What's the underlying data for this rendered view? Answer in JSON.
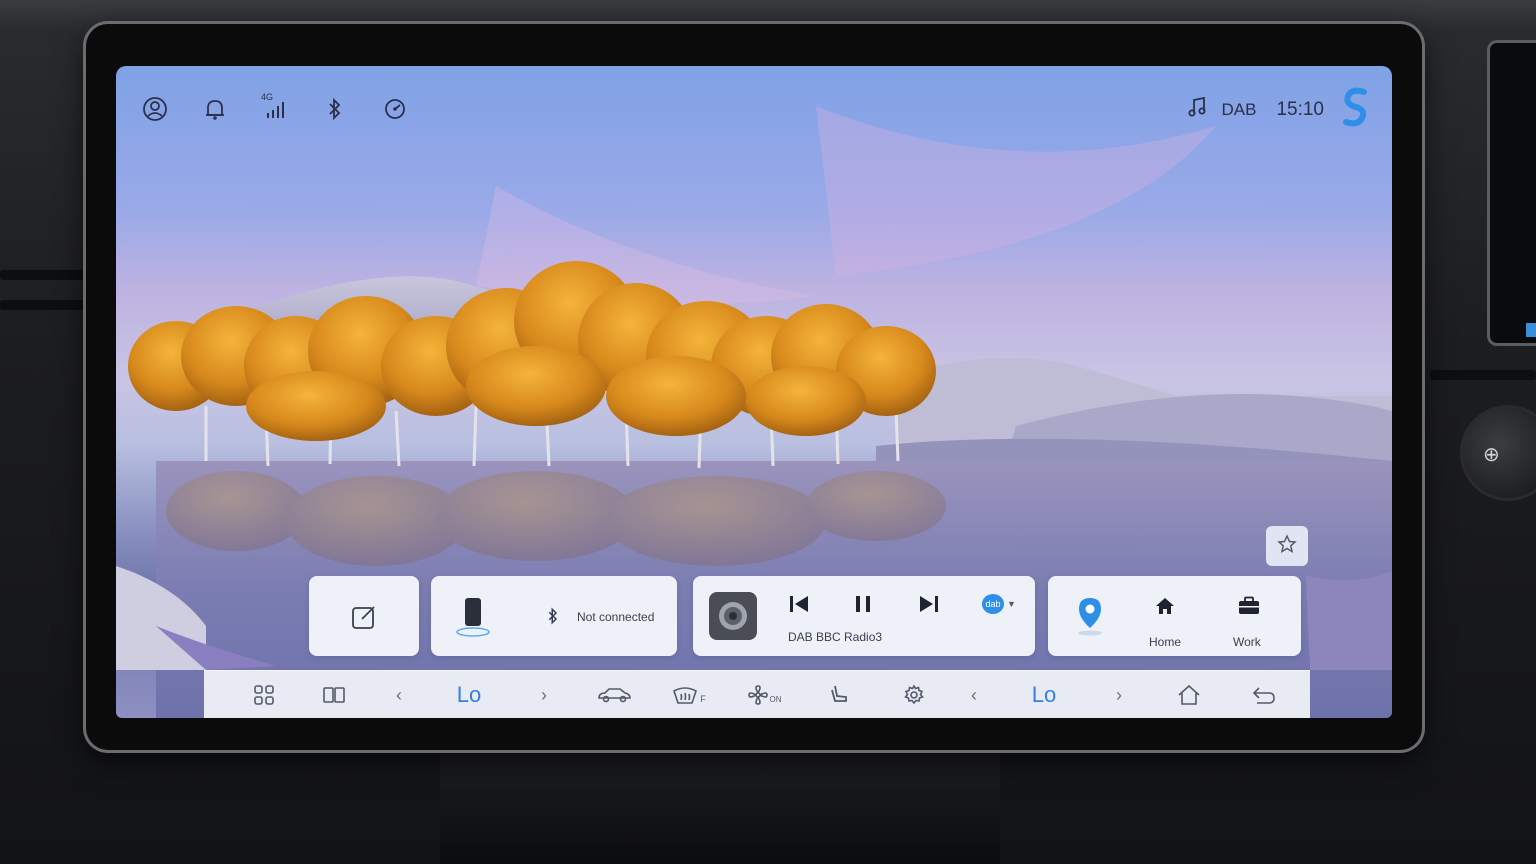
{
  "status_bar": {
    "icons": [
      "user-icon",
      "bell-icon",
      "cell-signal-icon",
      "bluetooth-icon",
      "gauge-icon"
    ],
    "network_label": "4G",
    "source_label": "DAB",
    "time": "15:10"
  },
  "phone_card": {
    "status": "Not connected"
  },
  "media_card": {
    "station": "DAB BBC Radio3",
    "source_badge": "dab"
  },
  "nav_card": {
    "home_label": "Home",
    "work_label": "Work"
  },
  "bottom_bar": {
    "left_temp": "Lo",
    "right_temp": "Lo",
    "defrost_suffix": "F",
    "fan_suffix": "ON"
  },
  "colors": {
    "accent": "#3a7fe0",
    "card_bg": "#f4f6fb",
    "bar_bg": "#eceef5"
  }
}
